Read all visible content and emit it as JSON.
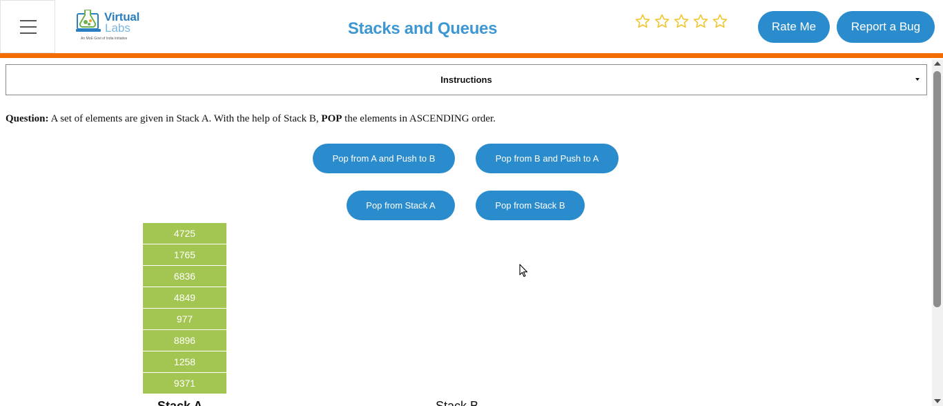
{
  "header": {
    "menu_icon": "hamburger-menu-icon",
    "logo": {
      "line1": "Virtual",
      "line2": "Labs",
      "tagline": "An MoE Govt of India Initiative"
    },
    "title": "Stacks and Queues",
    "rating": {
      "stars_filled": 0,
      "stars_total": 5,
      "star_color": "#f0c52e"
    },
    "rate_button": "Rate Me",
    "bug_button": "Report a Bug",
    "accent_color": "#f26c00",
    "button_color": "#2b8ccd"
  },
  "instructions": {
    "label": "Instructions"
  },
  "question": {
    "prefix": "Question:",
    "text_1": " A set of elements are given in Stack A. With the help of Stack B, ",
    "keyword": "POP",
    "text_2": " the elements in ASCENDING order."
  },
  "actions": {
    "pop_a_push_b": "Pop from A and Push to B",
    "pop_b_push_a": "Pop from B and Push to A",
    "pop_a": "Pop from Stack A",
    "pop_b": "Pop from Stack B"
  },
  "stack_a": {
    "label": "Stack A",
    "items": [
      "4725",
      "1765",
      "6836",
      "4849",
      "977",
      "8896",
      "1258",
      "9371"
    ],
    "color": "#a3c551"
  },
  "stack_b": {
    "label": "Stack B",
    "items": []
  }
}
